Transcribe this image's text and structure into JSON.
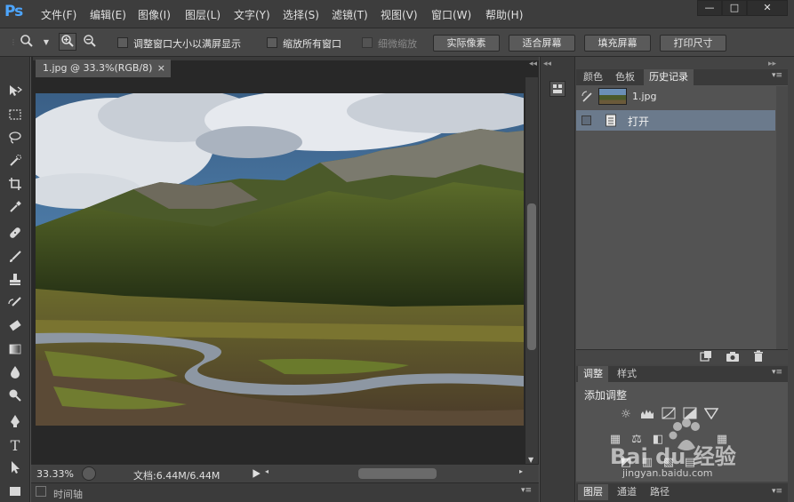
{
  "app": {
    "logo": "Ps",
    "menu": [
      "文件(F)",
      "编辑(E)",
      "图像(I)",
      "图层(L)",
      "文字(Y)",
      "选择(S)",
      "滤镜(T)",
      "视图(V)",
      "窗口(W)",
      "帮助(H)"
    ],
    "window_controls": [
      "—",
      "□",
      "✕"
    ]
  },
  "options": {
    "checkbox_resize": "调整窗口大小以满屏显示",
    "checkbox_zoom_all": "缩放所有窗口",
    "checkbox_scrubby": "细微缩放",
    "btn_actual": "实际像素",
    "btn_fit": "适合屏幕",
    "btn_fill": "填充屏幕",
    "btn_print": "打印尺寸"
  },
  "document": {
    "tab_title": "1.jpg @ 33.3%(RGB/8)",
    "close_glyph": "×",
    "zoom": "33.33%",
    "size": "文档:6.44M/6.44M"
  },
  "timeline": {
    "label": "时间轴"
  },
  "panels": {
    "history_tabs": [
      "颜色",
      "色板",
      "历史记录"
    ],
    "snapshot_name": "1.jpg",
    "history_items": [
      "打开"
    ],
    "adjust_tabs": [
      "调整",
      "样式"
    ],
    "adjust_title": "添加调整",
    "layer_tabs": [
      "图层",
      "通道",
      "路径"
    ]
  },
  "watermark": {
    "text": "Bai du 经验",
    "url": "jingyan.baidu.com"
  },
  "colors": {
    "accent_ps": "#4da6ff",
    "history_selected": "#6b7a8c"
  }
}
